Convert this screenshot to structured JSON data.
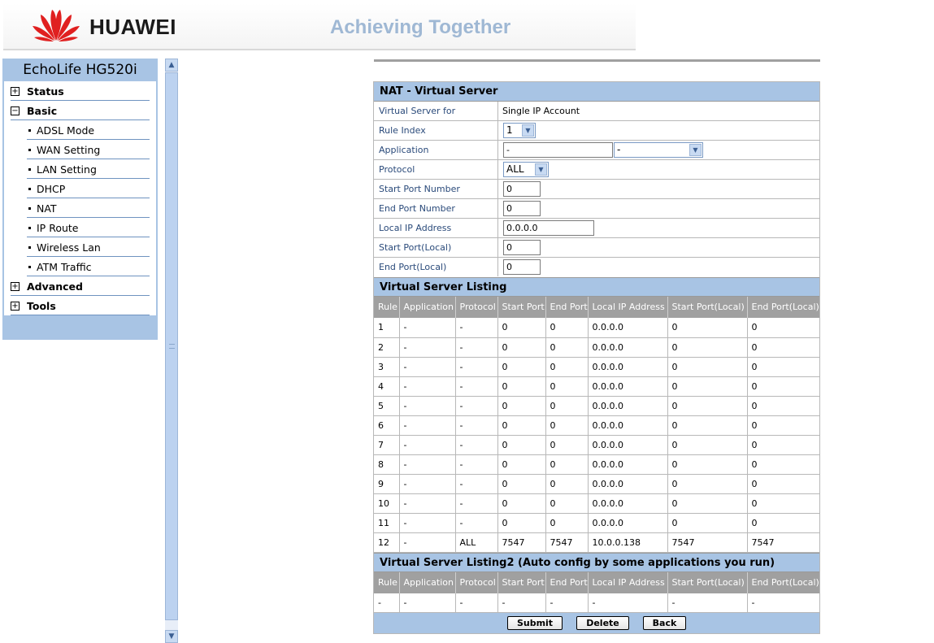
{
  "header": {
    "brand": "HUAWEI",
    "tagline": "Achieving Together",
    "logo_color": "#e02020"
  },
  "sidebar": {
    "title": "EchoLife HG520i",
    "items": [
      {
        "label": "Status",
        "expander": "+"
      },
      {
        "label": "Basic",
        "expander": "−"
      },
      {
        "label": "ADSL Mode"
      },
      {
        "label": "WAN Setting"
      },
      {
        "label": "LAN Setting"
      },
      {
        "label": "DHCP"
      },
      {
        "label": "NAT"
      },
      {
        "label": "IP Route"
      },
      {
        "label": "Wireless Lan"
      },
      {
        "label": "ATM Traffic"
      },
      {
        "label": "Advanced",
        "expander": "+"
      },
      {
        "label": "Tools",
        "expander": "+"
      }
    ]
  },
  "form": {
    "title": "NAT - Virtual Server",
    "fields": {
      "virtual_server_for": {
        "label": "Virtual Server for",
        "value": "Single IP Account"
      },
      "rule_index": {
        "label": "Rule Index",
        "value": "1"
      },
      "application": {
        "label": "Application",
        "value": "-",
        "select_value": "-"
      },
      "protocol": {
        "label": "Protocol",
        "value": "ALL"
      },
      "start_port": {
        "label": "Start Port Number",
        "value": "0"
      },
      "end_port": {
        "label": "End Port Number",
        "value": "0"
      },
      "local_ip": {
        "label": "Local IP Address",
        "value": "0.0.0.0"
      },
      "start_port_local": {
        "label": "Start Port(Local)",
        "value": "0"
      },
      "end_port_local": {
        "label": "End Port(Local)",
        "value": "0"
      }
    }
  },
  "listing": {
    "title": "Virtual Server Listing",
    "columns": [
      "Rule",
      "Application",
      "Protocol",
      "Start Port",
      "End Port",
      "Local IP Address",
      "Start Port(Local)",
      "End Port(Local)"
    ],
    "rows": [
      [
        "1",
        "-",
        "-",
        "0",
        "0",
        "0.0.0.0",
        "0",
        "0"
      ],
      [
        "2",
        "-",
        "-",
        "0",
        "0",
        "0.0.0.0",
        "0",
        "0"
      ],
      [
        "3",
        "-",
        "-",
        "0",
        "0",
        "0.0.0.0",
        "0",
        "0"
      ],
      [
        "4",
        "-",
        "-",
        "0",
        "0",
        "0.0.0.0",
        "0",
        "0"
      ],
      [
        "5",
        "-",
        "-",
        "0",
        "0",
        "0.0.0.0",
        "0",
        "0"
      ],
      [
        "6",
        "-",
        "-",
        "0",
        "0",
        "0.0.0.0",
        "0",
        "0"
      ],
      [
        "7",
        "-",
        "-",
        "0",
        "0",
        "0.0.0.0",
        "0",
        "0"
      ],
      [
        "8",
        "-",
        "-",
        "0",
        "0",
        "0.0.0.0",
        "0",
        "0"
      ],
      [
        "9",
        "-",
        "-",
        "0",
        "0",
        "0.0.0.0",
        "0",
        "0"
      ],
      [
        "10",
        "-",
        "-",
        "0",
        "0",
        "0.0.0.0",
        "0",
        "0"
      ],
      [
        "11",
        "-",
        "-",
        "0",
        "0",
        "0.0.0.0",
        "0",
        "0"
      ],
      [
        "12",
        "-",
        "ALL",
        "7547",
        "7547",
        "10.0.0.138",
        "7547",
        "7547"
      ]
    ]
  },
  "listing2": {
    "title": "Virtual Server Listing2 (Auto config by some applications you run)",
    "columns": [
      "Rule",
      "Application",
      "Protocol",
      "Start Port",
      "End Port",
      "Local IP Address",
      "Start Port(Local)",
      "End Port(Local)"
    ],
    "rows": [
      [
        "-",
        "-",
        "-",
        "-",
        "-",
        "-",
        "-",
        "-"
      ]
    ]
  },
  "buttons": {
    "submit": "Submit",
    "delete": "Delete",
    "back": "Back"
  },
  "icons": {
    "scroll_up": "chevron-up-icon",
    "scroll_down": "chevron-down-icon",
    "dropdown": "chevron-down-icon"
  }
}
